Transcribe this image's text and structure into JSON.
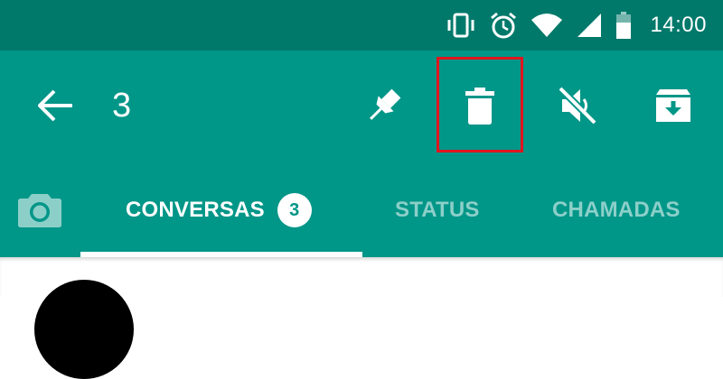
{
  "status_bar": {
    "time": "14:00",
    "icons": [
      "vibrate-icon",
      "alarm-icon",
      "wifi-icon",
      "signal-icon",
      "battery-icon"
    ]
  },
  "action_bar": {
    "selected_count": "3",
    "actions": [
      "pin-icon",
      "delete-icon",
      "mute-icon",
      "archive-icon"
    ],
    "highlight_color": "#E0151F"
  },
  "tabs": {
    "camera_icon": "camera-icon",
    "items": [
      {
        "label": "CONVERSAS",
        "badge": "3",
        "active": true
      },
      {
        "label": "STATUS",
        "active": false
      },
      {
        "label": "CHAMADAS",
        "active": false
      }
    ]
  },
  "colors": {
    "status_bar": "#00796B",
    "primary": "#009688",
    "text": "#ffffff"
  }
}
